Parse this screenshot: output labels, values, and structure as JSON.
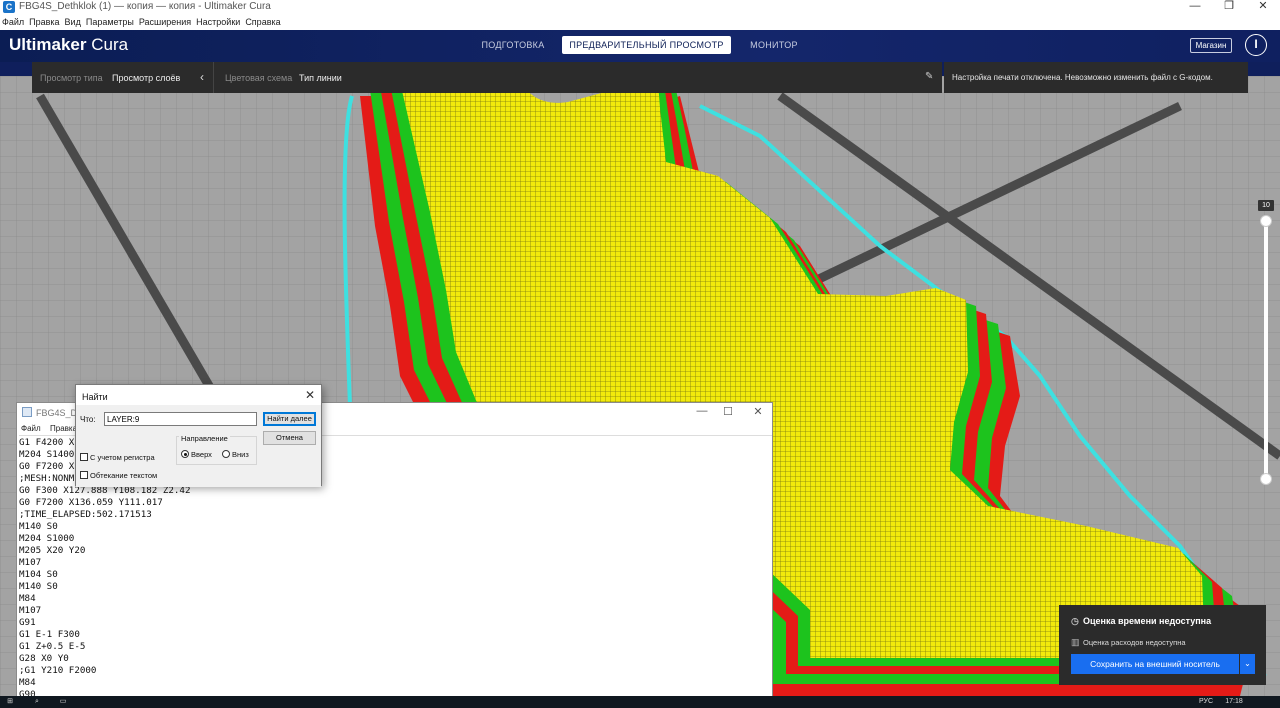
{
  "window": {
    "app_icon": "C",
    "title": "FBG4S_Dethklok (1) — копия — копия - Ultimaker Cura",
    "minimize": "—",
    "maximize": "❐",
    "close": "✕"
  },
  "menu": [
    "Файл",
    "Правка",
    "Вид",
    "Параметры",
    "Расширения",
    "Настройки",
    "Справка"
  ],
  "header": {
    "logo_bold": "Ultimaker",
    "logo_light": "Cura",
    "tabs": [
      {
        "label": "ПОДГОТОВКА",
        "active": false
      },
      {
        "label": "ПРЕДВАРИТЕЛЬНЫЙ ПРОСМОТР",
        "active": true
      },
      {
        "label": "МОНИТОР",
        "active": false
      }
    ],
    "shop_label": "Магазин",
    "account_icon": "I"
  },
  "viewbar": {
    "view_type_label": "Просмотр типа",
    "view_type_value": "Просмотр слоёв",
    "chevron": "‹",
    "color_scheme_label": "Цветовая схема",
    "color_scheme_value": "Тип линии",
    "edit_icon": "✎"
  },
  "print_message": "Настройка печати отключена. Невозможно изменить файл с G-кодом.",
  "layer_slider": {
    "current_layer": "10",
    "upper_fraction": 0.02,
    "lower_fraction": 1.0
  },
  "notepad": {
    "title": "FBG4S_Deth",
    "menu": [
      "Файл",
      "Правка"
    ],
    "minimize": "—",
    "maximize": "☐",
    "close": "✕",
    "lines": [
      "G1 F4200 X1",
      "M204 S1400",
      "G0 F7200 X1",
      ";MESH:NONME",
      "G0 F300 X127.888 Y108.182 Z2.42",
      "G0 F7200 X136.059 Y111.017",
      ";TIME_ELAPSED:502.171513",
      "M140 S0",
      "M204 S1000",
      "M205 X20 Y20",
      "M107",
      "M104 S0",
      "M140 S0",
      "M84",
      "M107",
      "G91",
      "G1 E-1 F300",
      "G1 Z+0.5 E-5",
      "G28 X0 Y0",
      ";G1 Y210 F2000",
      "M84",
      "G90"
    ]
  },
  "find_dialog": {
    "title": "Найти",
    "close": "✕",
    "what_label": "Что:",
    "search_value": "LAYER:9",
    "find_next": "Найти далее",
    "cancel": "Отмена",
    "direction_label": "Направление",
    "up_label": "Вверх",
    "down_label": "Вниз",
    "direction_selected": "up",
    "match_case": "С учетом регистра",
    "wrap_around": "Обтекание текстом",
    "match_case_checked": false,
    "wrap_around_checked": false
  },
  "toast": {
    "time_icon": "clock-icon",
    "time_text": "Оценка времени недоступна",
    "cost_icon": "spool-icon",
    "cost_text": "Оценка расходов недоступна",
    "save_button": "Сохранить на внешний носитель",
    "dropdown": "⌄"
  },
  "taskbar": {
    "lang": "РУС",
    "clock": "17:18"
  },
  "colors": {
    "header_bg": "#0b1d54",
    "toolbar_bg": "#2b2b2b",
    "infill": "#f2ea0c",
    "wall_outer": "#e41b17",
    "wall_inner": "#1dc31d",
    "travel": "#3ee0e0",
    "accent_button": "#196ef0"
  }
}
